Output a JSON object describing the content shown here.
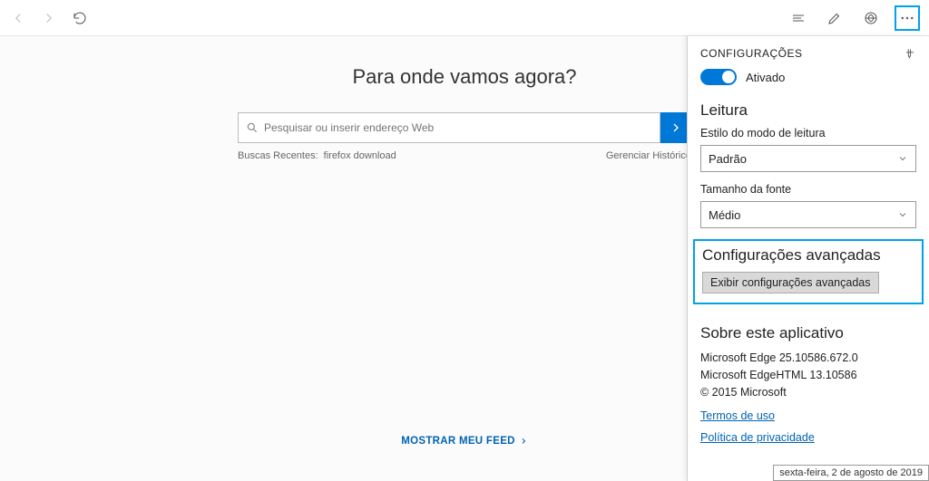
{
  "hero_prompt": "Para onde vamos agora?",
  "search": {
    "placeholder": "Pesquisar ou inserir endereço Web"
  },
  "recent": {
    "label": "Buscas Recentes:",
    "item": "firefox download",
    "history": "Gerenciar Histórico"
  },
  "feed_link": "MOSTRAR MEU FEED",
  "panel": {
    "title": "CONFIGURAÇÕES",
    "toggle_label": "Ativado",
    "reading": {
      "heading": "Leitura",
      "style_label": "Estilo do modo de leitura",
      "style_value": "Padrão",
      "font_label": "Tamanho da fonte",
      "font_value": "Médio"
    },
    "advanced": {
      "heading": "Configurações avançadas",
      "button": "Exibir configurações avançadas"
    },
    "about": {
      "heading": "Sobre este aplicativo",
      "line1": "Microsoft Edge 25.10586.672.0",
      "line2": "Microsoft EdgeHTML 13.10586",
      "line3": "© 2015 Microsoft",
      "terms": "Termos de uso",
      "privacy": "Política de privacidade"
    }
  },
  "tooltip": "sexta-feira, 2 de agosto de 2019"
}
